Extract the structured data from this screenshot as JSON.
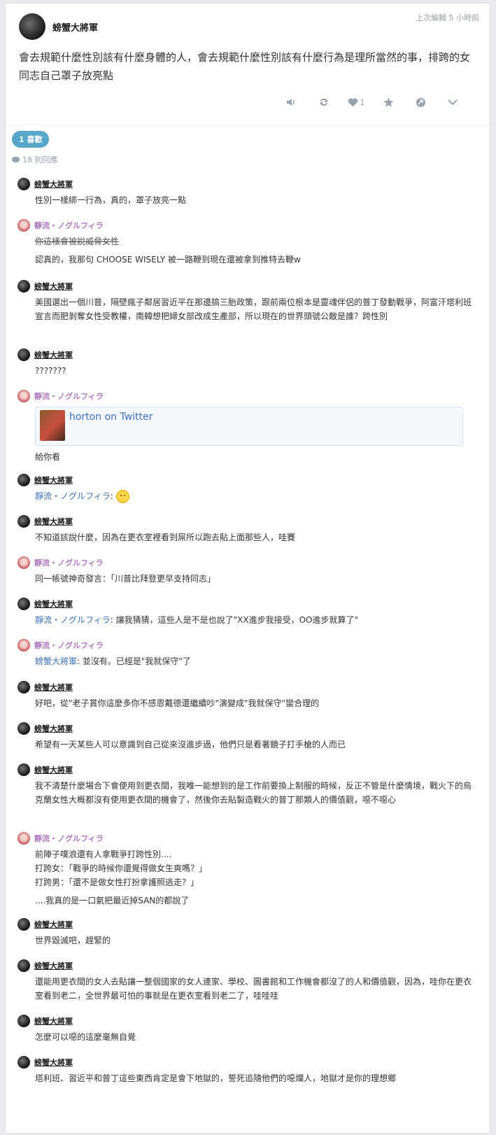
{
  "post": {
    "author": "螃蟹大將軍",
    "edited": "上次編輯 5 小時前",
    "body": "會去規範什麼性別該有什麼身體的人，會去規範什麼性別該有什麼行為是理所當然的事，排跨的女同志自己罩子放亮點",
    "like_count": "1"
  },
  "actions": {
    "volume_icon": "volume-icon",
    "repost_icon": "repost-icon",
    "like_icon": "heart-icon",
    "star_icon": "star-icon",
    "share_icon": "share-icon",
    "more_icon": "chevron-down-icon"
  },
  "likes_label": "1 喜歡",
  "replies_label": "18 則回應",
  "comments": [
    {
      "author": "螃蟹大將軍",
      "lines": [
        "性別一樣綁一行為，真的，罩子放亮一點"
      ]
    },
    {
      "author": "靜流・ノグルフィラ",
      "strike": "你這樣會被說威脅女性",
      "lines": [
        "認真的，我那句 CHOOSE WISELY 被一路鞭到現在還被拿到推特去鞭w"
      ]
    },
    {
      "author": "螃蟹大將軍",
      "lines": [
        "美國選出一個川普，隔壁瘋子鄰居習近平在那邊搞三胎政策，跟前兩位根本是靈魂伴侶的普丁發動戰爭，阿富汗塔利班宣言而肥剝奪女性受教權，南韓想把婦女部改成生產部，所以現在的世界頭號公敵是誰？跨性別"
      ]
    },
    {
      "author": "螃蟹大將軍",
      "lines": [
        "???????"
      ]
    },
    {
      "author": "靜流・ノグルフィラ",
      "embed_title": "horton on Twitter",
      "lines": [
        "給你看"
      ]
    },
    {
      "author": "螃蟹大將軍",
      "mention": "靜流・ノグルフィラ",
      "lines": [
        ""
      ]
    },
    {
      "author": "螃蟹大將軍",
      "lines": [
        "不知道該說什麼，因為在更衣室裡看到屌所以跑去貼上面那些人，哇賽"
      ]
    },
    {
      "author": "靜流・ノグルフィラ",
      "lines": [
        "同一帳號神奇發言：「川普比拜登更早支持同志」"
      ]
    },
    {
      "author": "螃蟹大將軍",
      "mention": "靜流・ノグルフィラ",
      "lines": [
        "讓我猜猜，這些人是不是也說了\"XX進步我接受，OO進步就算了\""
      ]
    },
    {
      "author": "靜流・ノグルフィラ",
      "mention": "螃蟹大將軍",
      "lines": [
        "並沒有。已經是\"我就保守\"了"
      ]
    },
    {
      "author": "螃蟹大將軍",
      "lines": [
        "好吧，從\"老子賞你這麼多你不感恩戴德還繼續吵\"演變成\"我就保守\"蠻合理的"
      ]
    },
    {
      "author": "螃蟹大將軍",
      "lines": [
        "希望有一天某些人可以意識到自己從來沒進步過，他們只是看著鏡子打手槍的人而已"
      ]
    },
    {
      "author": "螃蟹大將軍",
      "lines": [
        "我不清楚什麼場合下會使用到更衣間，我唯一能想到的是工作前要換上制服的時候，反正不管是什麼情境，戰火下的烏克蘭女性大概都沒有使用更衣間的機會了，然後你去貼製造戰火的普丁那類人的價值觀，噁不噁心"
      ]
    },
    {
      "author": "靜流・ノグルフィラ",
      "lines": [
        "前陣子噗浪還有人拿戰爭打跨性別....",
        "打跨女：「戰爭的時候你還覺得做女生爽嗎？」",
        "打跨男：「還不是做女性打扮拿護照逃走？」"
      ],
      "extra": "....我真的是一口氣把最近掉SAN的都說了"
    },
    {
      "author": "螃蟹大將軍",
      "lines": [
        "世界毀滅吧，趕緊的"
      ]
    },
    {
      "author": "螃蟹大將軍",
      "lines": [
        "還能用更衣間的女人去貼讓一整個國家的女人連家、學校、圖書館和工作機會都沒了的人和價值觀，因為，哇你在更衣室看到老二，全世界最可怕的事就是在更衣室看到老二了，哇哇哇"
      ]
    },
    {
      "author": "螃蟹大將軍",
      "lines": [
        "怎麼可以噁的這麼毫無自覺"
      ]
    },
    {
      "author": "螃蟹大將軍",
      "lines": [
        "塔利班、習近平和普丁這些東西肯定是會下地獄的，誓死追隨他們的噁爛人，地獄才是你的理想鄉"
      ]
    }
  ]
}
